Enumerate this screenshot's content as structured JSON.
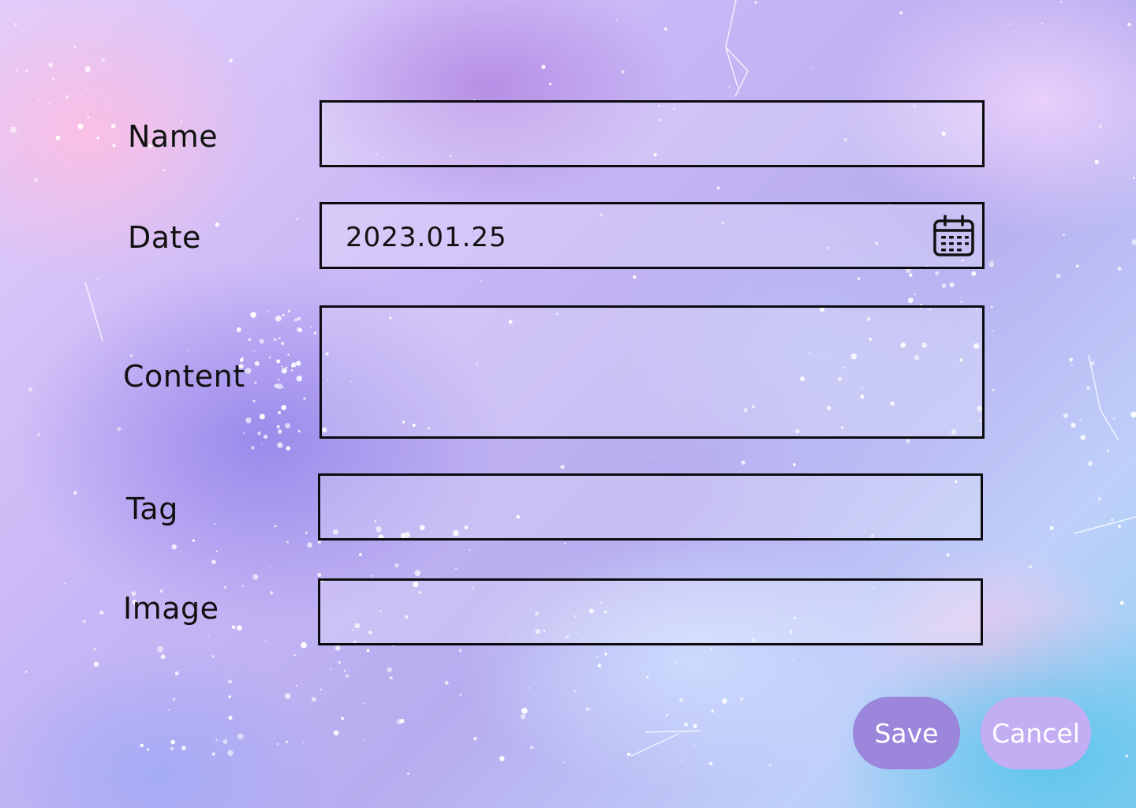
{
  "form": {
    "name": {
      "label": "Name",
      "value": ""
    },
    "date": {
      "label": "Date",
      "value": "2023.01.25"
    },
    "content": {
      "label": "Content",
      "value": ""
    },
    "tag": {
      "label": "Tag",
      "value": ""
    },
    "image": {
      "label": "Image",
      "value": ""
    }
  },
  "icons": {
    "date_picker": "calendar-icon"
  },
  "actions": {
    "save_label": "Save",
    "cancel_label": "Cancel"
  },
  "colors": {
    "save_button": "#9b86dc",
    "cancel_button": "#c3adf3",
    "field_border": "#0c0c10",
    "label_text": "#111111"
  }
}
